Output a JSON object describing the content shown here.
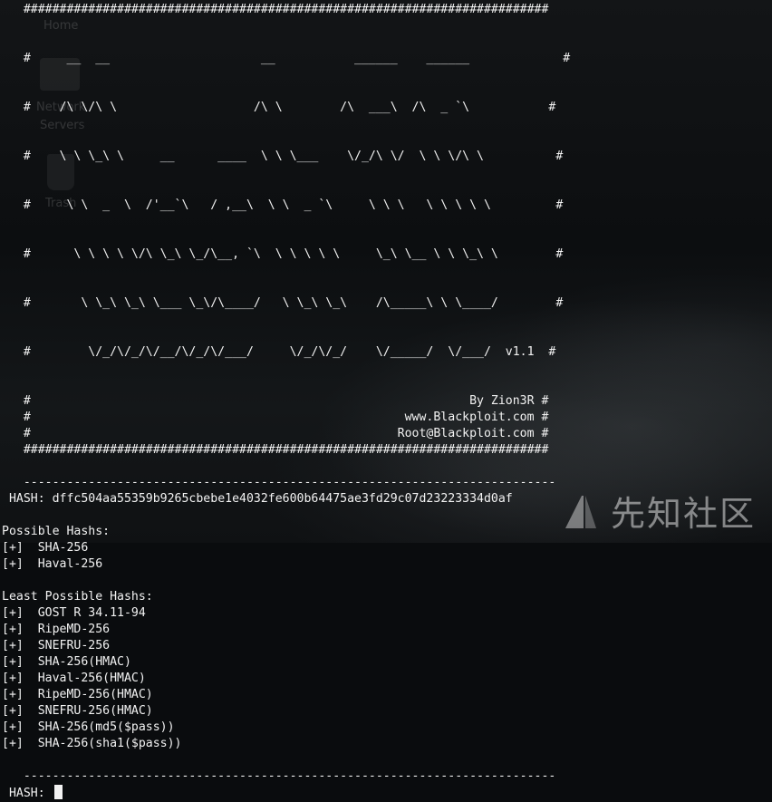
{
  "desktop": {
    "home_label": "Home",
    "network_label": "Network",
    "servers_label": "Servers",
    "trash_label": "Trash"
  },
  "banner": {
    "border": "   #########################################################################",
    "art": [
      "   #     __  __                     __           ______    ______             #",
      "   #    /\\ \\/\\ \\                   /\\ \\        /\\  ___\\  /\\  _ `\\           #",
      "   #    \\ \\ \\_\\ \\     __      ____  \\ \\ \\___    \\/_/\\ \\/  \\ \\ \\/\\ \\          #",
      "   #     \\ \\  _  \\  /'__`\\   / ,__\\  \\ \\  _ `\\     \\ \\ \\   \\ \\ \\ \\ \\         #",
      "   #      \\ \\ \\ \\ \\/\\ \\_\\ \\_/\\__, `\\  \\ \\ \\ \\ \\     \\_\\ \\__ \\ \\ \\_\\ \\        #",
      "   #       \\ \\_\\ \\_\\ \\___ \\_\\/\\____/   \\ \\_\\ \\_\\    /\\_____\\ \\ \\____/        #",
      "   #        \\/_/\\/_/\\/__/\\/_/\\/___/     \\/_/\\/_/    \\/_____/  \\/___/  v1.1  #"
    ],
    "credits": [
      "   #                                                             By Zion3R #",
      "   #                                                    www.Blackploit.com #",
      "   #                                                   Root@Blackploit.com #"
    ],
    "separator": "   --------------------------------------------------------------------------"
  },
  "hash": {
    "prompt": " HASH: ",
    "value": "dffc504aa55359b9265cbebe1e4032fe600b64475ae3fd29c07d23223334d0af"
  },
  "possible": {
    "title": "Possible Hashs:",
    "prefix": "[+]  ",
    "items": [
      "SHA-256",
      "Haval-256"
    ]
  },
  "least": {
    "title": "Least Possible Hashs:",
    "prefix": "[+]  ",
    "items": [
      "GOST R 34.11-94",
      "RipeMD-256",
      "SNEFRU-256",
      "SHA-256(HMAC)",
      "Haval-256(HMAC)",
      "RipeMD-256(HMAC)",
      "SNEFRU-256(HMAC)",
      "SHA-256(md5($pass))",
      "SHA-256(sha1($pass))"
    ]
  },
  "input_prompt": " HASH: ",
  "watermark": {
    "text": "先知社区",
    "logo_icon": "xianzhi-logo-icon"
  }
}
